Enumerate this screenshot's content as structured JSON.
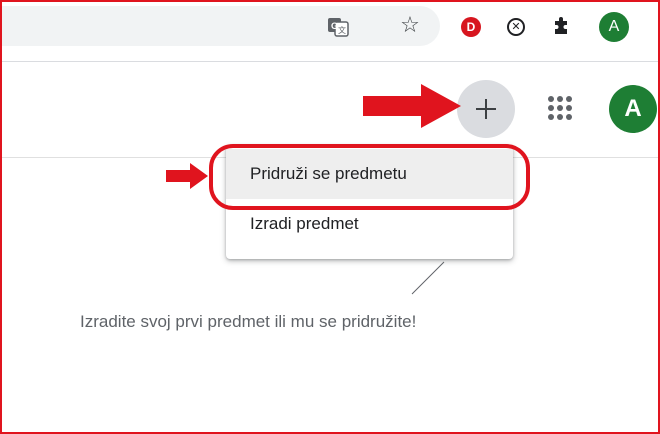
{
  "browser": {
    "extensions": [
      {
        "name": "translate",
        "glyph": "G"
      },
      {
        "name": "bookmark",
        "glyph": "☆"
      },
      {
        "name": "d-extension",
        "glyph": "D"
      },
      {
        "name": "x-extension",
        "glyph": "✕"
      },
      {
        "name": "extensions",
        "glyph": "✱"
      }
    ],
    "profile_initial": "A"
  },
  "header": {
    "account_initial": "A"
  },
  "menu": {
    "items": [
      {
        "label": "Pridruži se predmetu"
      },
      {
        "label": "Izradi predmet"
      }
    ]
  },
  "main": {
    "empty_message": "Izradite svoj prvi predmet ili mu se pridružite!"
  },
  "colors": {
    "annotation_red": "#e0141e",
    "avatar_green": "#1e7e34",
    "plus_button_bg": "#dadce0"
  }
}
